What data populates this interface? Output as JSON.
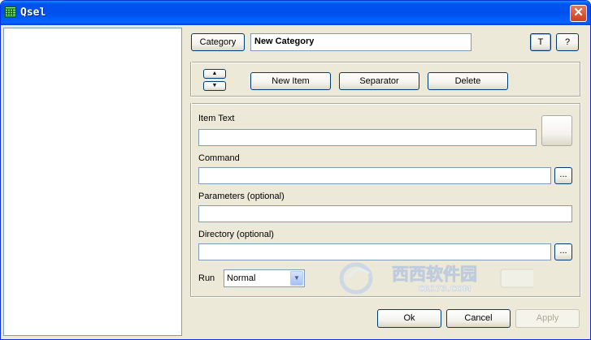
{
  "window": {
    "title": "Qsel",
    "close_symbol": "✕"
  },
  "header": {
    "category_button": "Category",
    "category_name": "New Category",
    "t_button": "T",
    "help_button": "?"
  },
  "toolbar": {
    "up_symbol": "▲",
    "down_symbol": "▼",
    "new_item": "New Item",
    "separator": "Separator",
    "delete": "Delete"
  },
  "form": {
    "item_text_label": "Item Text",
    "item_text_value": "",
    "command_label": "Command",
    "command_value": "",
    "browse_label": "...",
    "parameters_label": "Parameters (optional)",
    "parameters_value": "",
    "directory_label": "Directory (optional)",
    "directory_value": "",
    "run_label": "Run",
    "run_value": "Normal",
    "run_dropdown_symbol": "▼"
  },
  "footer": {
    "ok": "Ok",
    "cancel": "Cancel",
    "apply": "Apply"
  },
  "watermark": {
    "line1": "西西软件园",
    "line2": "CR173.COM"
  }
}
